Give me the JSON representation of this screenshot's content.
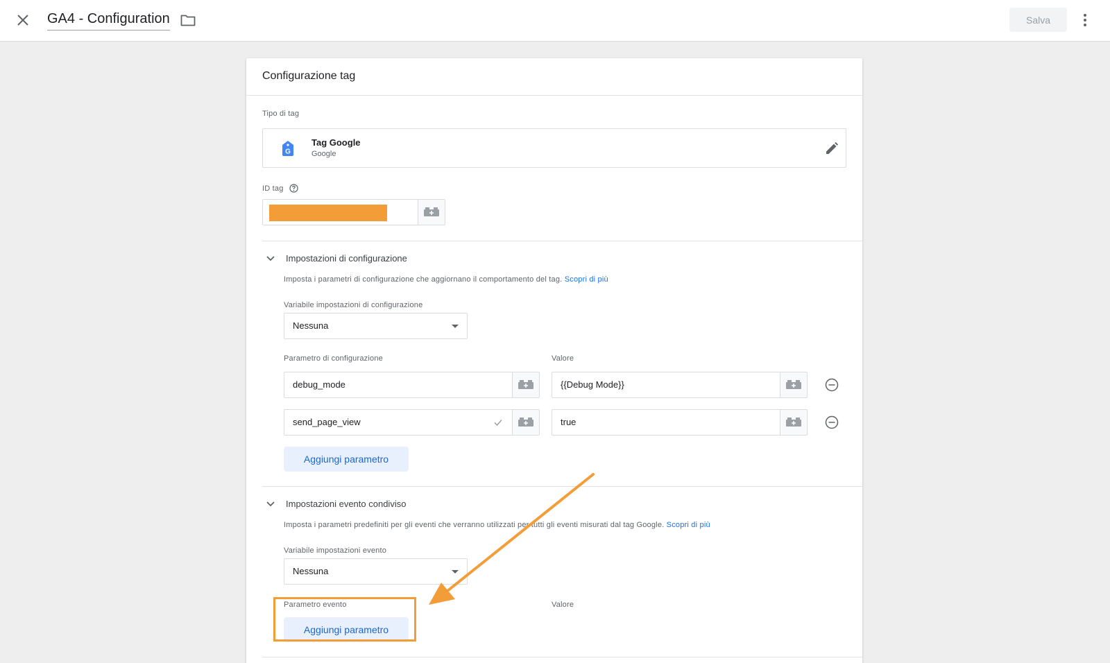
{
  "topbar": {
    "title": "GA4 - Configuration",
    "save_label": "Salva"
  },
  "card": {
    "header": "Configurazione tag",
    "tag_type": {
      "label": "Tipo di tag",
      "name": "Tag Google",
      "vendor": "Google"
    },
    "tag_id": {
      "label": "ID tag"
    },
    "config_settings": {
      "title": "Impostazioni di configurazione",
      "description": "Imposta i parametri di configurazione che aggiornano il comportamento del tag.",
      "learn_more": "Scopri di più",
      "variable_label": "Variabile impostazioni di configurazione",
      "variable_value": "Nessuna",
      "param_header": "Parametro di configurazione",
      "value_header": "Valore",
      "rows": [
        {
          "param": "debug_mode",
          "value": "{{Debug Mode}}"
        },
        {
          "param": "send_page_view",
          "value": "true"
        }
      ],
      "add_label": "Aggiungi parametro"
    },
    "event_settings": {
      "title": "Impostazioni evento condiviso",
      "description": "Imposta i parametri predefiniti per gli eventi che verranno utilizzati per tutti gli eventi misurati dal tag Google.",
      "learn_more": "Scopri di più",
      "variable_label": "Variabile impostazioni evento",
      "variable_value": "Nessuna",
      "param_header": "Parametro evento",
      "value_header": "Valore",
      "add_label": "Aggiungi parametro"
    }
  },
  "colors": {
    "accent": "#1a73e8",
    "annotation": "#f29d38"
  }
}
